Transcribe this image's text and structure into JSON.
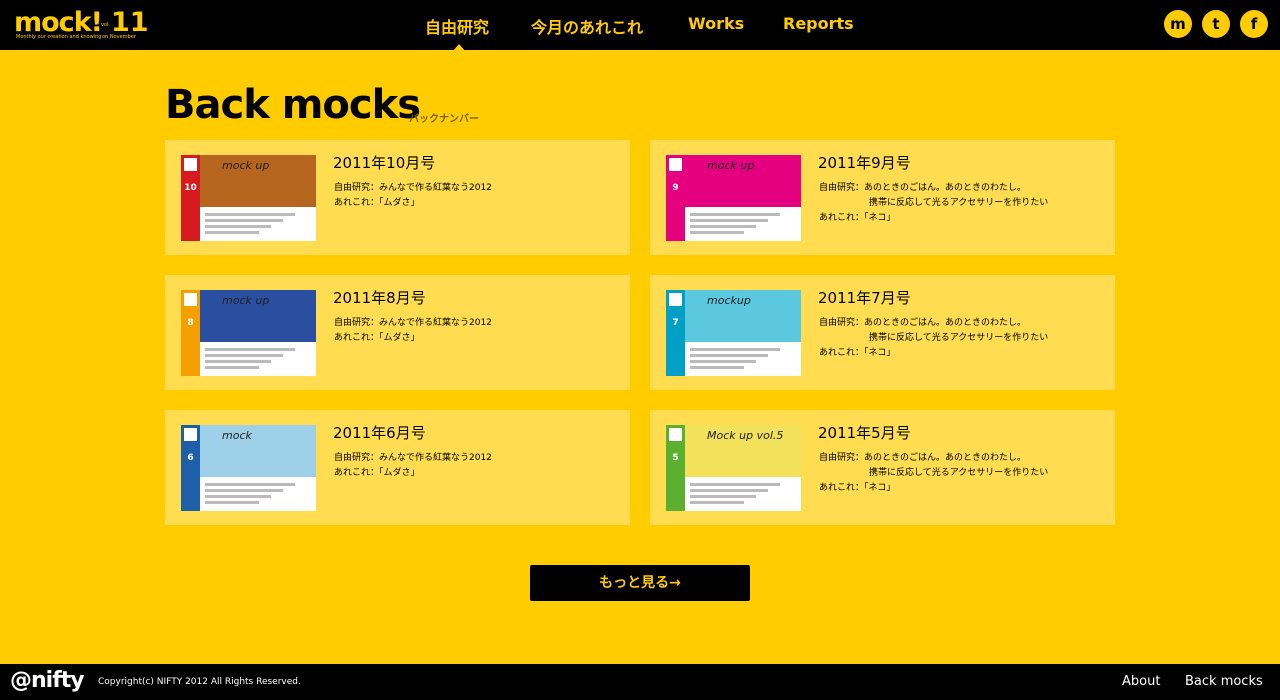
{
  "header": {
    "logo_word": "mock!",
    "logo_issue": "11",
    "logo_vol": "vol.",
    "logo_tagline": "Monthly our creation and knowing",
    "logo_month": "on November",
    "nav": [
      "自由研究",
      "今月のあれこれ",
      "Works",
      "Reports"
    ],
    "social": [
      {
        "name": "mock",
        "glyph": "m"
      },
      {
        "name": "twitter",
        "glyph": "t"
      },
      {
        "name": "facebook",
        "glyph": "f"
      }
    ]
  },
  "main": {
    "title": "Back mocks",
    "subtitle": "バックナンバー",
    "issues": [
      {
        "number": "10",
        "color": "#d71920",
        "hero": "#b5651d",
        "thumb_text": "mock up",
        "title": "2011年10月号",
        "lines": [
          "自由研究：みんなで作る紅葉なう2012",
          "あれこれ：「ムダさ」"
        ]
      },
      {
        "number": "9",
        "color": "#e4007f",
        "hero": "#e4007f",
        "thumb_text": "mock up",
        "title": "2011年9月号",
        "lines": [
          "自由研究：あのときのごはん。あのときのわたし。",
          "携帯に反応して光るアクセサリーを作りたい",
          "あれこれ：「ネコ」"
        ]
      },
      {
        "number": "8",
        "color": "#f5a000",
        "hero": "#2a4ea0",
        "thumb_text": "mock up",
        "title": "2011年8月号",
        "lines": [
          "自由研究：みんなで作る紅葉なう2012",
          "あれこれ：「ムダさ」"
        ]
      },
      {
        "number": "7",
        "color": "#00a0c6",
        "hero": "#5cc8e0",
        "thumb_text": "mockup",
        "title": "2011年7月号",
        "lines": [
          "自由研究：あのときのごはん。あのときのわたし。",
          "携帯に反応して光るアクセサリーを作りたい",
          "あれこれ：「ネコ」"
        ]
      },
      {
        "number": "6",
        "color": "#1d5fa8",
        "hero": "#9fd0ea",
        "thumb_text": "mock",
        "title": "2011年6月号",
        "lines": [
          "自由研究：みんなで作る紅葉なう2012",
          "あれこれ：「ムダさ」"
        ]
      },
      {
        "number": "5",
        "color": "#5bb12f",
        "hero": "#f2e15a",
        "thumb_text": "Mock up vol.5",
        "title": "2011年5月号",
        "lines": [
          "自由研究：あのときのごはん。あのときのわたし。",
          "携帯に反応して光るアクセサリーを作りたい",
          "あれこれ：「ネコ」"
        ]
      }
    ],
    "more_label": "もっと見る→"
  },
  "footer": {
    "logo": "@nifty",
    "copyright": "Copyright(c) NIFTY 2012 All Rights Reserved.",
    "links": [
      "About",
      "Back mocks"
    ]
  },
  "colors": {
    "brand_yellow": "#ffcc00",
    "card_bg": "#ffdc50",
    "header_bg": "#000000"
  }
}
